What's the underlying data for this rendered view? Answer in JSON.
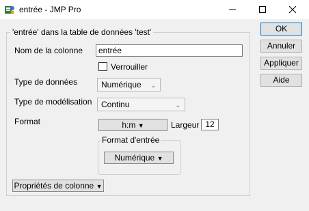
{
  "window": {
    "title": "entrée - JMP Pro",
    "minimize_glyph": "—",
    "maximize_glyph": "☐",
    "close_glyph": "✕"
  },
  "group": {
    "title": "'entrée' dans la table de données 'test'"
  },
  "fields": {
    "column_name_label": "Nom de la colonne",
    "column_name_value": "entrée",
    "lock_label": "Verrouiller",
    "lock_checked": false,
    "data_type_label": "Type de données",
    "data_type_value": "Numérique",
    "model_type_label": "Type de modélisation",
    "model_type_value": "Continu",
    "format_label": "Format",
    "format_value": "h:m",
    "width_label": "Largeur",
    "width_value": "12",
    "input_format_label": "Format d'entrée",
    "input_format_value": "Numérique",
    "column_props_label": "Propriétés de colonne"
  },
  "buttons": {
    "ok": "OK",
    "cancel": "Annuler",
    "apply": "Appliquer",
    "help": "Aide"
  },
  "icons": {
    "app": "jmp-app-icon",
    "dropdown": "triangle-down-icon",
    "chevron": "chevron-down-icon"
  }
}
